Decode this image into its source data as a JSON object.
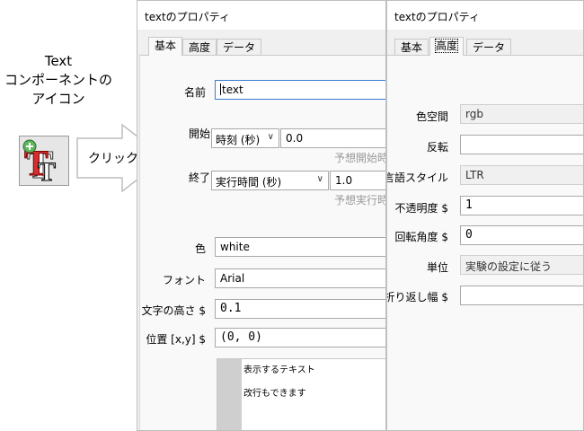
{
  "left": {
    "caption_lines": [
      "Text",
      "コンポーネントの",
      "アイコン"
    ],
    "icon": "text-component-icon",
    "arrow_label": "クリック"
  },
  "window_basic": {
    "title": "textのプロパティ",
    "tabs": [
      {
        "label": "基本",
        "active": true
      },
      {
        "label": "高度",
        "active": false
      },
      {
        "label": "データ",
        "active": false
      }
    ],
    "fields": {
      "name_label": "名前",
      "name_value": "text",
      "start_label": "開始",
      "start_type": "時刻 (秒)",
      "start_value": "0.0",
      "start_hint": "予想開始時",
      "end_label": "終了",
      "end_type": "実行時間 (秒)",
      "end_value": "1.0",
      "end_hint": "予想実行時",
      "color_label": "色",
      "color_value": "white",
      "font_label": "フォント",
      "font_value": "Arial",
      "height_label": "文字の高さ $",
      "height_value": "0.1",
      "pos_label": "位置 [x,y] $",
      "pos_value": "(0, 0)",
      "text_line1": "表示するテキスト",
      "text_line2": "改行もできます"
    }
  },
  "window_advanced": {
    "title": "textのプロパティ",
    "tabs": [
      {
        "label": "基本",
        "active": false
      },
      {
        "label": "高度",
        "active": true
      },
      {
        "label": "データ",
        "active": false
      }
    ],
    "fields": {
      "colorspace_label": "色空間",
      "colorspace_value": "rgb",
      "flip_label": "反転",
      "flip_value": "",
      "lang_label": "言語スタイル",
      "lang_value": "LTR",
      "opacity_label": "不透明度 $",
      "opacity_value": "1",
      "ori_label": "回転角度 $",
      "ori_value": "0",
      "units_label": "単位",
      "units_value": "実験の設定に従う",
      "wrap_label": "折り返し幅 $",
      "wrap_value": ""
    }
  }
}
